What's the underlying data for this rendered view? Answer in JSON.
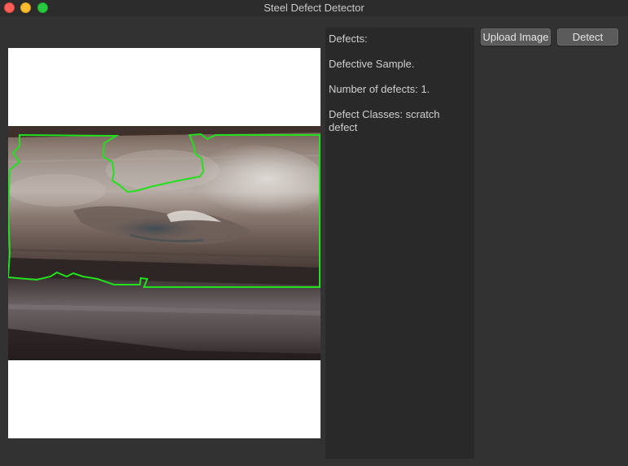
{
  "window": {
    "title": "Steel Defect Detector"
  },
  "image_panel": {
    "subject": "steel-bar-photo",
    "outline_color": "#22e01d"
  },
  "results": {
    "heading": "Defects:",
    "status": "Defective Sample.",
    "count": "Number of defects: 1.",
    "classes": "Defect Classes: scratch defect"
  },
  "toolbar": {
    "upload_label": "Upload Image",
    "detect_label": "Detect"
  }
}
